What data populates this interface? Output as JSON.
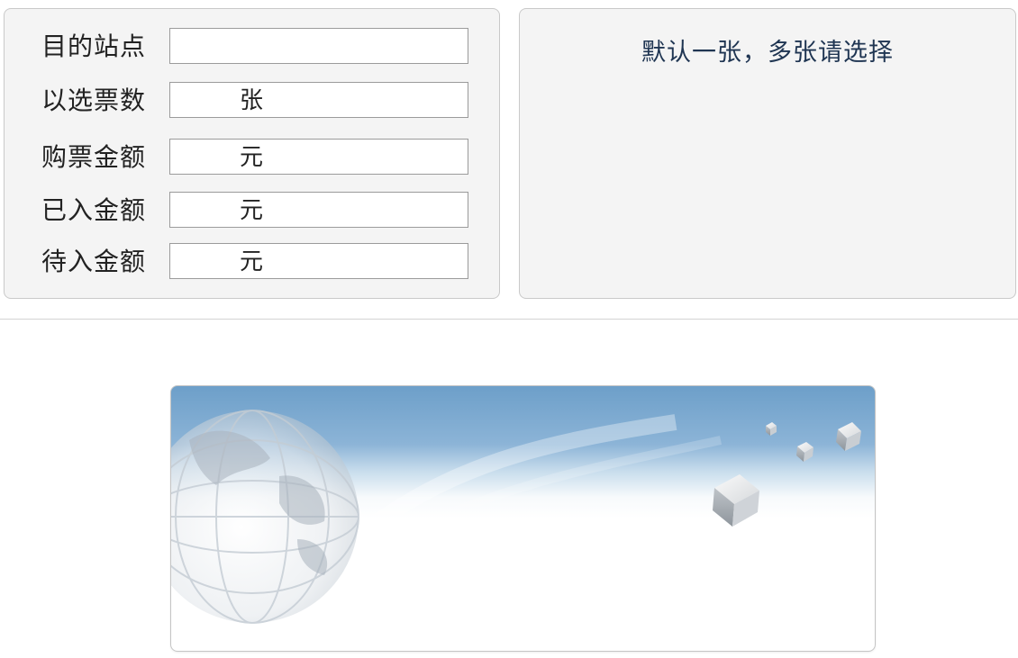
{
  "form": {
    "rows": [
      {
        "label": "目的站点",
        "unit": ""
      },
      {
        "label": "以选票数",
        "unit": "张"
      },
      {
        "label": "购票金额",
        "unit": "元"
      },
      {
        "label": "已入金额",
        "unit": "元"
      },
      {
        "label": "待入金额",
        "unit": "元"
      }
    ]
  },
  "ticket_panel": {
    "hint": "默认一张，多张请选择"
  },
  "banner": {
    "icon": "globe-and-cubes-illustration"
  },
  "colors": {
    "panel_bg": "#f4f4f4",
    "hint_text": "#1f3552",
    "banner_top": "#6d9fc9"
  }
}
